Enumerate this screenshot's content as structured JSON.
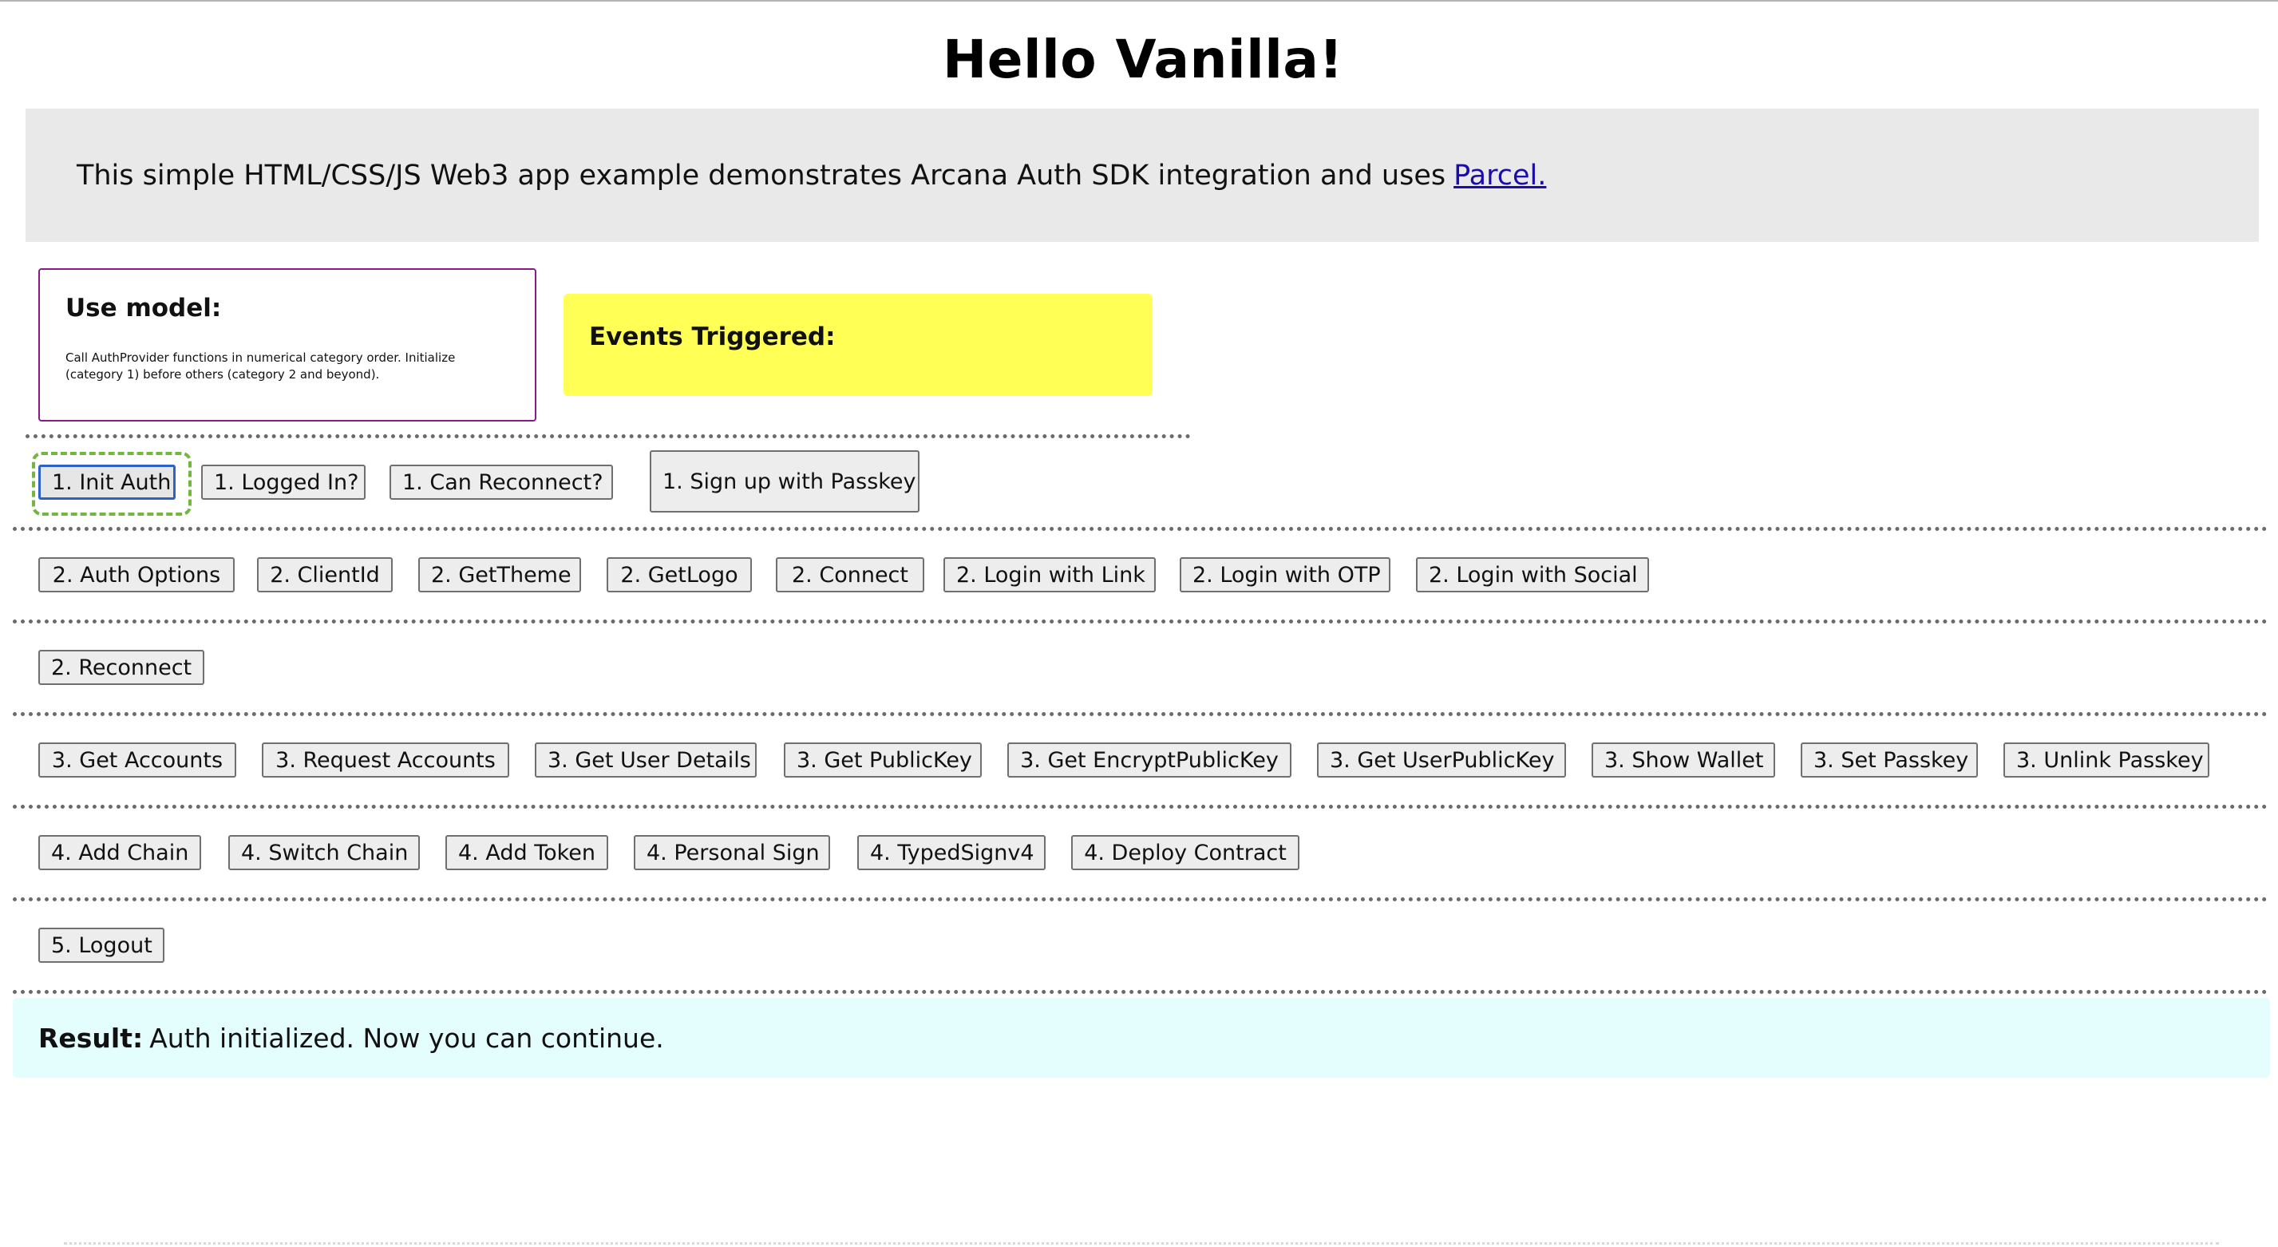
{
  "page": {
    "title": "Hello Vanilla!",
    "intro_text": "This simple HTML/CSS/JS Web3 app example demonstrates Arcana Auth SDK integration and uses",
    "intro_link": "Parcel."
  },
  "use_model": {
    "heading": "Use model:",
    "text": "Call AuthProvider functions in numerical category order. Initialize (category 1) before others (category 2 and beyond)."
  },
  "events": {
    "heading": "Events Triggered:"
  },
  "buttons": {
    "row1": [
      "1. Init Auth",
      "1. Logged In?",
      "1. Can Reconnect?",
      "1. Sign up with Passkey"
    ],
    "row2": [
      "2. Auth Options",
      "2. ClientId",
      "2. GetTheme",
      "2. GetLogo",
      "2. Connect",
      "2. Login with Link",
      "2. Login with OTP",
      "2. Login with Social"
    ],
    "row3": [
      "2. Reconnect"
    ],
    "row4": [
      "3. Get Accounts",
      "3. Request Accounts",
      "3. Get User Details",
      "3. Get PublicKey",
      "3. Get EncryptPublicKey",
      "3. Get UserPublicKey",
      "3. Show Wallet",
      "3. Set Passkey",
      "3. Unlink Passkey"
    ],
    "row5": [
      "4. Add Chain",
      "4. Switch Chain",
      "4. Add Token",
      "4. Personal Sign",
      "4. TypedSignv4",
      "4. Deploy Contract"
    ],
    "row6": [
      "5. Logout"
    ]
  },
  "result": {
    "label": "Result:",
    "text": "Auth initialized. Now you can continue."
  }
}
